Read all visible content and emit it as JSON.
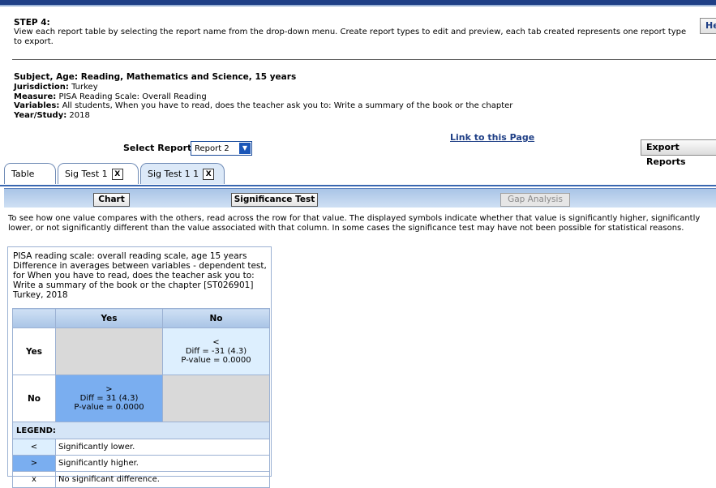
{
  "step": {
    "title": "STEP 4:",
    "text": "View each report table by selecting the report name from the drop-down menu. Create report types to edit and preview, each tab created represents one report type to export.",
    "help_label": "He"
  },
  "info": {
    "subject": "Subject, Age: Reading, Mathematics and Science, 15 years",
    "jurisdiction_label": "Jurisdiction:",
    "jurisdiction": "Turkey",
    "measure_label": "Measure:",
    "measure": "PISA Reading Scale: Overall Reading",
    "variables_label": "Variables:",
    "variables": "All students, When you have to read, does the teacher ask you to: Write a summary of the book or the chapter",
    "year_label": "Year/Study:",
    "year": "2018"
  },
  "report": {
    "link_label": "Link to this Page",
    "select_label": "Select Report:",
    "selected": "Report 2",
    "export_label": "Export Reports"
  },
  "tabs": [
    {
      "label": "Table"
    },
    {
      "label": "Sig Test 1",
      "close": "X"
    },
    {
      "label": "Sig Test 1 1",
      "close": "X"
    }
  ],
  "subtabs": {
    "chart": "Chart",
    "significance": "Significance Test",
    "gap": "Gap Analysis"
  },
  "description": "To see how one value compares with the others, read across the row for that value. The displayed symbols indicate whether that value is significantly higher, significantly lower, or not significantly different than the value associated with that column. In some cases the significance test may have not been possible for statistical reasons.",
  "table": {
    "caption_lines": [
      "PISA reading scale: overall reading scale, age 15 years",
      "Difference in averages between variables - dependent test,",
      "for When you have to read, does the teacher ask you to:",
      "Write a summary of the book or the chapter [ST026901]",
      "Turkey, 2018"
    ],
    "col_headers": [
      "Yes",
      "No"
    ],
    "rows": [
      {
        "label": "Yes",
        "cells": [
          {
            "symbol": "",
            "diff": "",
            "pvalue": ""
          },
          {
            "symbol": "<",
            "diff": "Diff = -31 (4.3)",
            "pvalue": "P-value = 0.0000"
          }
        ]
      },
      {
        "label": "No",
        "cells": [
          {
            "symbol": ">",
            "diff": "Diff = 31 (4.3)",
            "pvalue": "P-value = 0.0000"
          },
          {
            "symbol": "",
            "diff": "",
            "pvalue": ""
          }
        ]
      }
    ],
    "legend_title": "LEGEND:",
    "legend": [
      {
        "symbol": "<",
        "text": "Significantly lower."
      },
      {
        "symbol": ">",
        "text": "Significantly higher."
      },
      {
        "symbol": "x",
        "text": "No significant difference."
      }
    ]
  }
}
